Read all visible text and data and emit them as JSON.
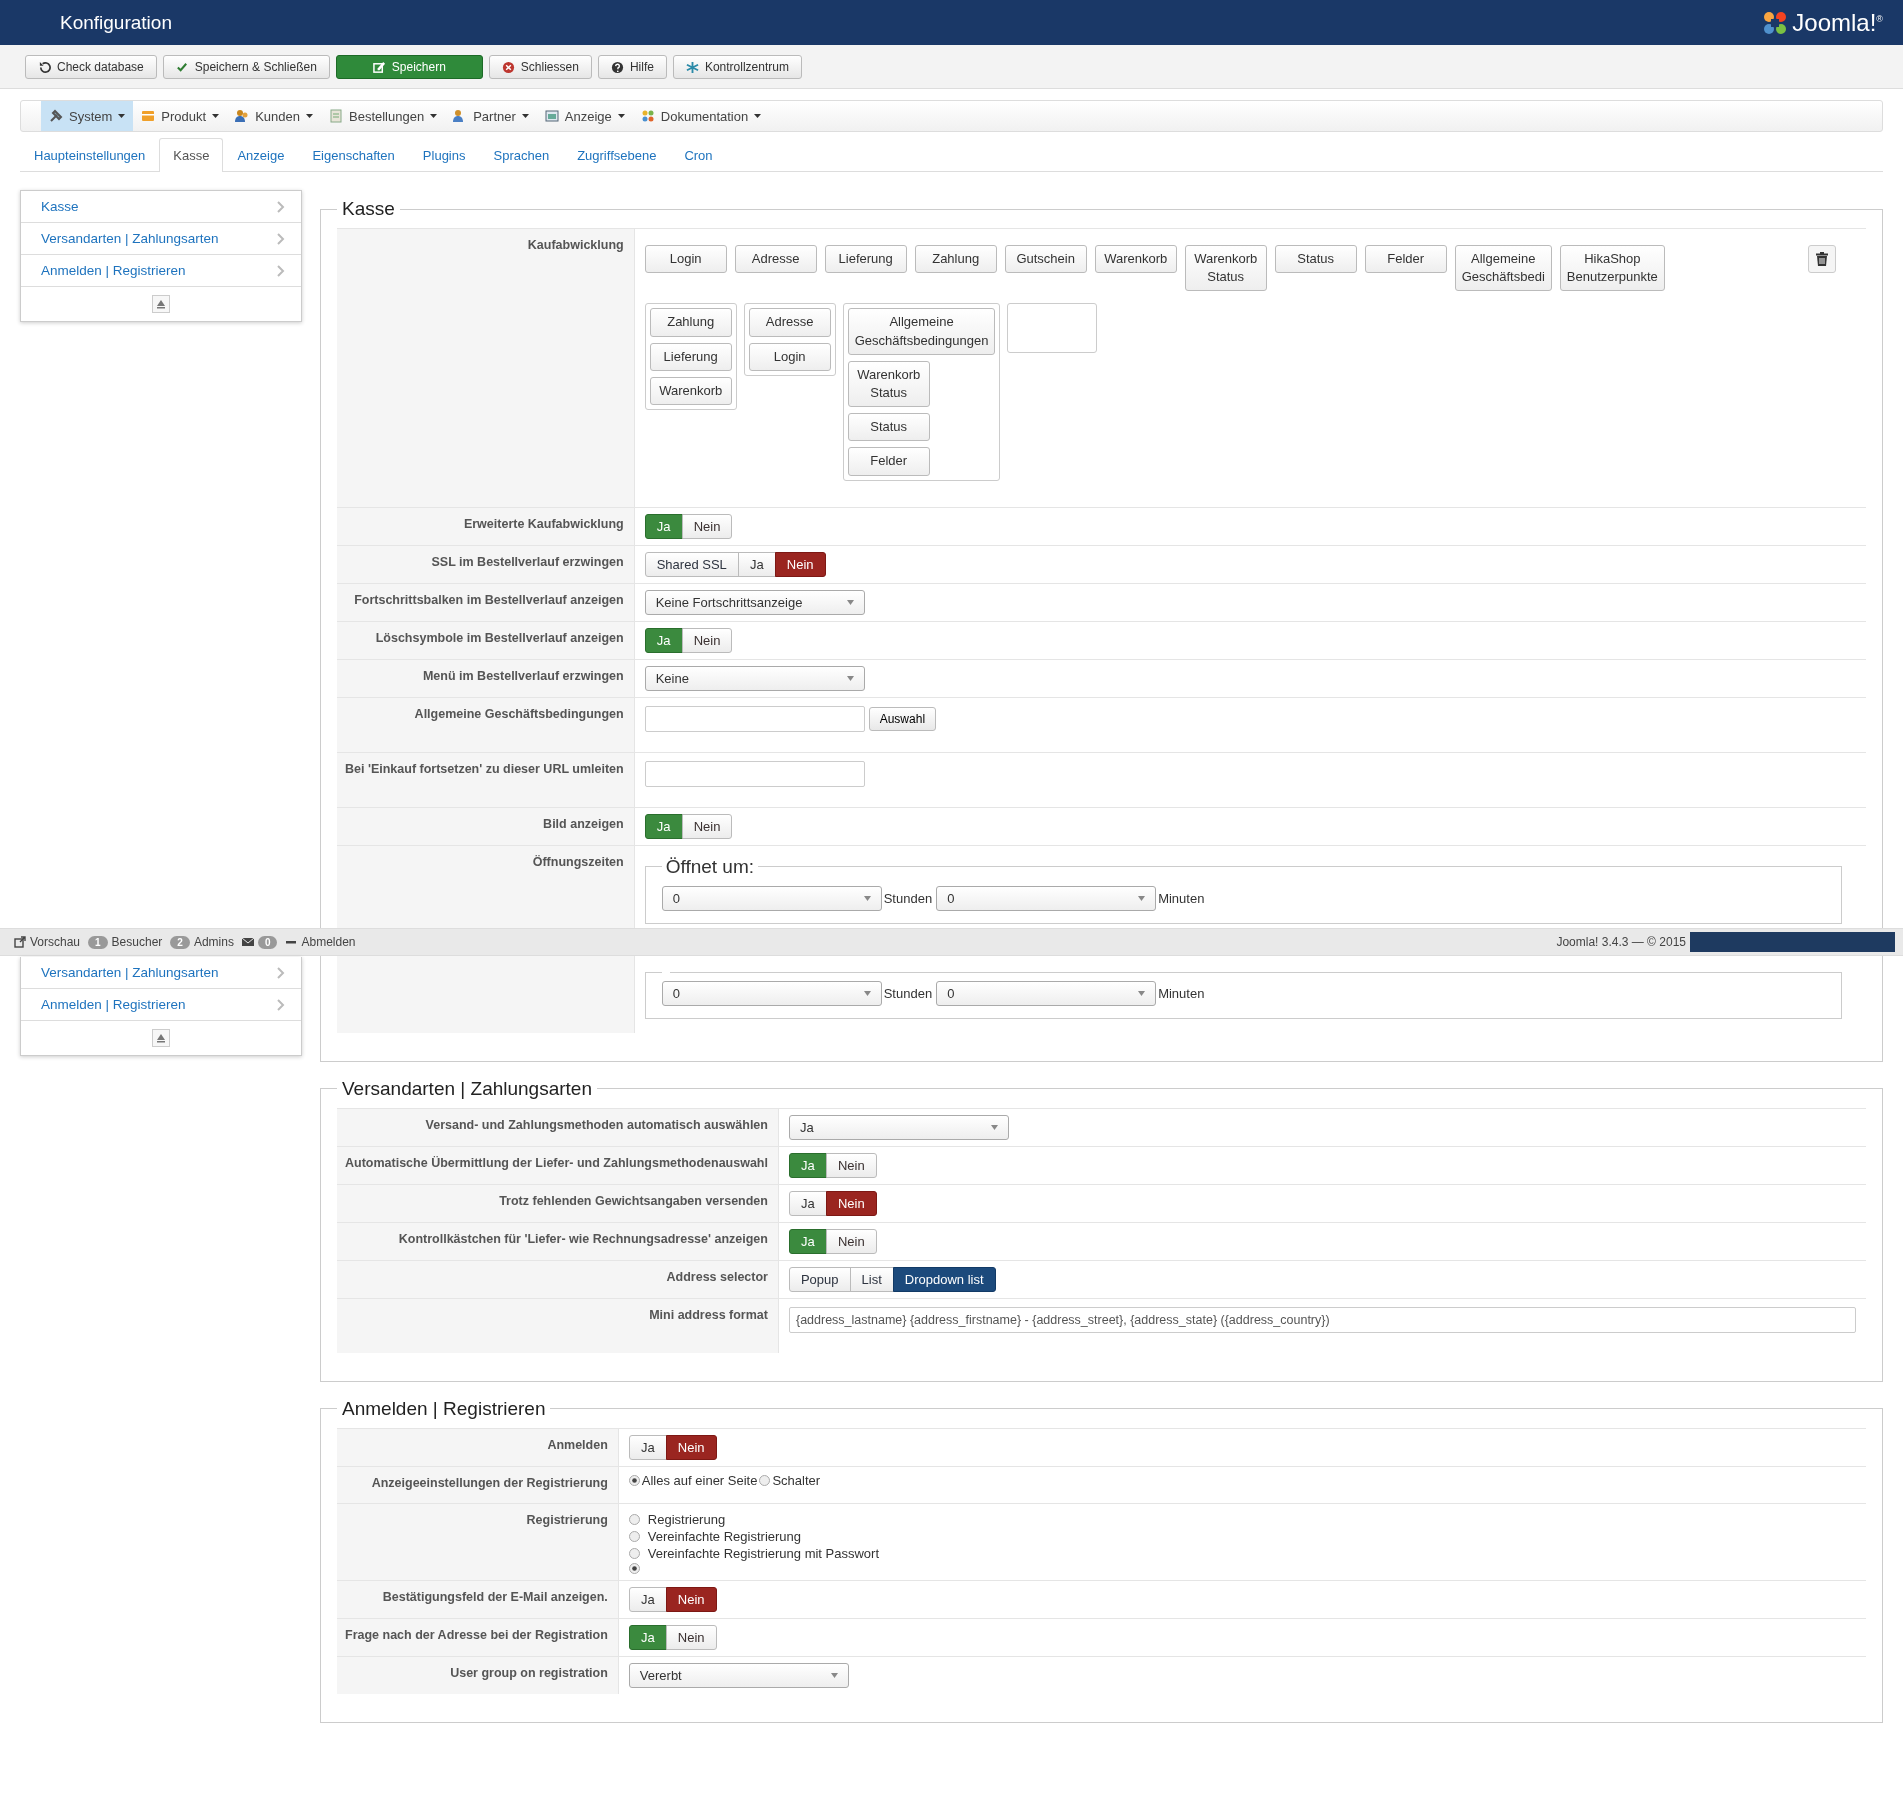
{
  "header": {
    "title": "Konfiguration",
    "logo": "Joomla!$^{®}$"
  },
  "toolbar": [
    {
      "label": "Check database",
      "primary": false
    },
    {
      "label": "Speichern & Schließen",
      "primary": false
    },
    {
      "label": "Speichern",
      "primary": true
    },
    {
      "label": "Schliessen",
      "primary": false
    },
    {
      "label": "Hilfe",
      "primary": false
    },
    {
      "label": "Kontrollzentrum",
      "primary": false
    }
  ],
  "menu": [
    {
      "label": "System",
      "selected": true
    },
    {
      "label": "Produkt",
      "selected": false
    },
    {
      "label": "Kunden",
      "selected": false
    },
    {
      "label": "Bestellungen",
      "selected": false
    },
    {
      "label": "Partner",
      "selected": false
    },
    {
      "label": "Anzeige",
      "selected": false
    },
    {
      "label": "Dokumentation",
      "selected": false
    }
  ],
  "tabs": [
    {
      "label": "Haupteinstellungen",
      "selected": false
    },
    {
      "label": "Kasse",
      "selected": true
    },
    {
      "label": "Anzeige",
      "selected": false
    },
    {
      "label": "Eigenschaften",
      "selected": false
    },
    {
      "label": "Plugins",
      "selected": false
    },
    {
      "label": "Sprachen",
      "selected": false
    },
    {
      "label": "Zugriffsebene",
      "selected": false
    },
    {
      "label": "Cron",
      "selected": false
    }
  ],
  "sidebar": {
    "items": [
      "Kasse",
      "Versandarten | Zahlungsarten",
      "Anmelden | Registrieren"
    ]
  },
  "sections": [
    {
      "title": "Kasse",
      "rows": [
        {
          "kind": "steps",
          "label": "Kaufabwicklung",
          "available": [
            "Login",
            "Adresse",
            "Lieferung",
            "Zahlung",
            "Gutschein",
            "Warenkorb",
            "Warenkorb Status",
            "Status",
            "Felder",
            "Allgemeine Geschäftsbedi",
            "HikaShop Benutzerpunkte"
          ],
          "columns": [
            {
              "kind": "group",
              "steps": [
                "Zahlung",
                "Lieferung",
                "Warenkorb"
              ]
            },
            {
              "kind": "group",
              "steps": [
                "Adresse",
                "Login"
              ]
            },
            {
              "kind": "group",
              "steps": [
                "Allgemeine Geschäftsbedingungen",
                "Warenkorb Status",
                "Status",
                "Felder"
              ]
            },
            {
              "kind": "empty"
            }
          ]
        },
        {
          "kind": "toggle",
          "label": "Erweiterte Kaufabwicklung",
          "options": [
            {
              "label": "Ja",
              "kind": "yes",
              "selected": true
            },
            {
              "label": "Nein",
              "kind": "no",
              "selected": false
            }
          ]
        },
        {
          "kind": "toggle",
          "label": "SSL im Bestellverlauf erzwingen",
          "options": [
            {
              "label": "Shared SSL",
              "kind": "other",
              "selected": false
            },
            {
              "label": "Ja",
              "kind": "yes",
              "selected": false
            },
            {
              "label": "Nein",
              "kind": "no",
              "selected": true
            }
          ]
        },
        {
          "kind": "select",
          "label": "Fortschrittsbalken im Bestellverlauf anzeigen",
          "value": "Keine Fortschrittsanzeige"
        },
        {
          "kind": "toggle",
          "label": "Löschsymbole im Bestellverlauf anzeigen",
          "options": [
            {
              "label": "Ja",
              "kind": "yes",
              "selected": true
            },
            {
              "label": "Nein",
              "kind": "no",
              "selected": false
            }
          ]
        },
        {
          "kind": "select",
          "label": "Menü im Bestellverlauf erzwingen",
          "value": "Keine"
        },
        {
          "kind": "field_button",
          "label": "Allgemeine Geschäftsbedingungen",
          "button": "Auswahl"
        },
        {
          "kind": "field",
          "label": "Bei 'Einkauf fortsetzen' zu dieser URL umleiten"
        },
        {
          "kind": "toggle",
          "label": "Bild anzeigen",
          "options": [
            {
              "label": "Ja",
              "kind": "yes",
              "selected": true
            },
            {
              "label": "Nein",
              "kind": "no",
              "selected": false
            }
          ]
        },
        {
          "kind": "times",
          "label": "Öffnungszeiten",
          "groups": [
            {
              "legend": "Öffnet um:",
              "hours": "0",
              "hours_unit": "Stunden",
              "minutes": "0",
              "minutes_unit": "Minuten"
            },
            {
              "hours": "0",
              "hours_unit": "Stunden",
              "minutes": "0",
              "minutes_unit": "Minuten"
            }
          ]
        }
      ]
    },
    {
      "title": "Versandarten | Zahlungsarten",
      "rows": [
        {
          "kind": "select",
          "label": "Versand- und Zahlungsmethoden automatisch auswählen",
          "value": "Ja"
        },
        {
          "kind": "toggle",
          "label": "Automatische Übermittlung der Liefer- und Zahlungsmethodenauswahl",
          "options": [
            {
              "label": "Ja",
              "kind": "yes",
              "selected": true
            },
            {
              "label": "Nein",
              "kind": "no",
              "selected": false
            }
          ]
        },
        {
          "kind": "toggle",
          "label": "Trotz fehlenden Gewichtsangaben versenden",
          "options": [
            {
              "label": "Ja",
              "kind": "yes",
              "selected": false
            },
            {
              "label": "Nein",
              "kind": "no",
              "selected": true
            }
          ]
        },
        {
          "kind": "toggle",
          "label": "Kontrollkästchen für 'Liefer- wie Rechnungsadresse' anzeigen",
          "options": [
            {
              "label": "Ja",
              "kind": "yes",
              "selected": true
            },
            {
              "label": "Nein",
              "kind": "no",
              "selected": false
            }
          ]
        },
        {
          "kind": "toggle",
          "label": "Address selector",
          "options": [
            {
              "label": "Popup",
              "kind": "other",
              "selected": false
            },
            {
              "label": "List",
              "kind": "other",
              "selected": false
            },
            {
              "label": "Dropdown list",
              "kind": "other",
              "selected": true
            }
          ]
        },
        {
          "kind": "wide_field",
          "label": "Mini address format",
          "value": "{address_lastname} {address_firstname} - {address_street}, {address_state} ({address_country})"
        }
      ]
    },
    {
      "title": "Anmelden | Registrieren",
      "rows": [
        {
          "kind": "toggle",
          "label": "Anmelden",
          "options": [
            {
              "label": "Ja",
              "kind": "yes",
              "selected": false
            },
            {
              "label": "Nein",
              "kind": "no",
              "selected": true
            }
          ]
        },
        {
          "kind": "radio_inline",
          "label": "Anzeigeeinstellungen der Registrierung",
          "options": [
            {
              "label": "Alles auf einer Seite",
              "selected": true
            },
            {
              "label": "Schalter",
              "selected": false
            }
          ]
        },
        {
          "kind": "radio_list",
          "label": "Registrierung",
          "options": [
            {
              "label": "Registrierung",
              "selected": false
            },
            {
              "label": "Vereinfachte Registrierung",
              "selected": false
            },
            {
              "label": "Vereinfachte Registrierung mit Passwort",
              "selected": false
            },
            {
              "selected": true
            }
          ]
        },
        {
          "kind": "toggle",
          "label": "Bestätigungsfeld der E-Mail anzeigen.",
          "options": [
            {
              "label": "Ja",
              "kind": "yes",
              "selected": false
            },
            {
              "label": "Nein",
              "kind": "no",
              "selected": true
            }
          ]
        },
        {
          "kind": "toggle",
          "label": "Frage nach der Adresse bei der Registration",
          "options": [
            {
              "label": "Ja",
              "kind": "yes",
              "selected": true
            },
            {
              "label": "Nein",
              "kind": "no",
              "selected": false
            }
          ]
        },
        {
          "kind": "select",
          "label": "User group on registration",
          "value": "Vererbt"
        }
      ]
    }
  ],
  "footer": {
    "items": [
      {
        "kind": "link",
        "label": "Vorschau"
      },
      {
        "kind": "badge",
        "count": "1",
        "label": "Besucher"
      },
      {
        "kind": "badge",
        "count": "2",
        "label": "Admins"
      },
      {
        "kind": "mail",
        "count": "0"
      },
      {
        "kind": "logout",
        "label": "Abmelden"
      }
    ],
    "version": "Joomla! 3.4.3 — © 2015"
  },
  "sticky_sidebar": {
    "items": [
      "Versandarten | Zahlungsarten",
      "Anmelden | Registrieren"
    ]
  }
}
